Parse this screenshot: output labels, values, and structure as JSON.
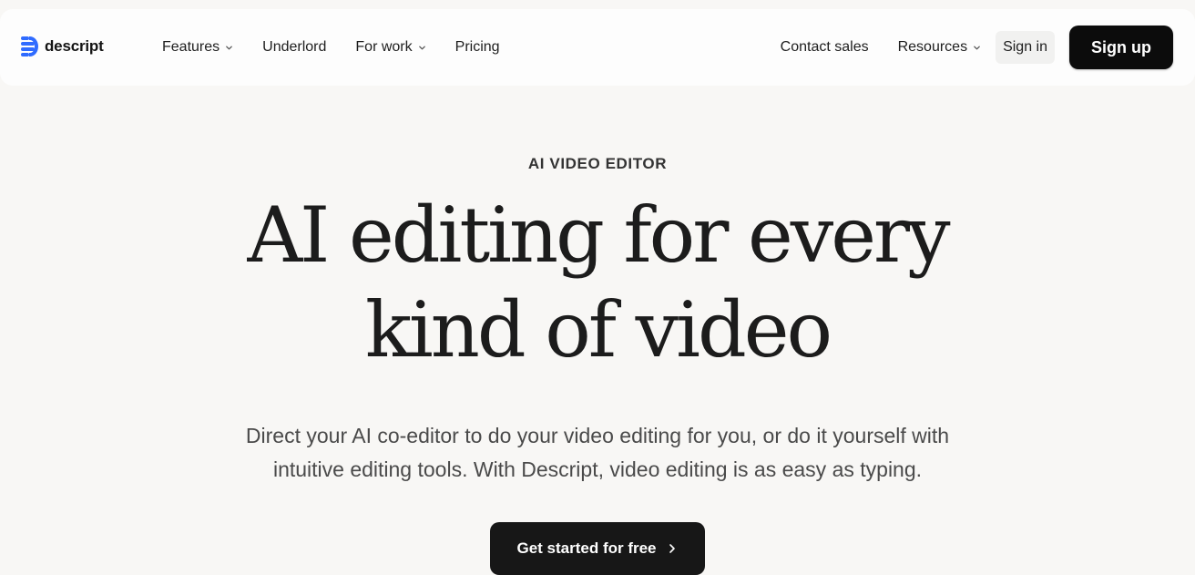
{
  "brand": {
    "name": "descript",
    "logo_icon": "descript-logo-icon",
    "accent_color": "#2f6bff"
  },
  "nav": {
    "left_items": [
      {
        "label": "Features",
        "dropdown": true
      },
      {
        "label": "Underlord",
        "dropdown": false
      },
      {
        "label": "For work",
        "dropdown": true
      },
      {
        "label": "Pricing",
        "dropdown": false
      }
    ],
    "right_items": [
      {
        "label": "Contact sales",
        "dropdown": false
      },
      {
        "label": "Resources",
        "dropdown": true
      }
    ],
    "sign_in_label": "Sign in",
    "sign_up_label": "Sign up",
    "chevron_icon": "chevron-down-icon"
  },
  "hero": {
    "eyebrow": "AI VIDEO EDITOR",
    "headline_line1": "AI editing for every",
    "headline_line2": "kind of video",
    "subcopy_line1": "Direct your AI co-editor to do your video editing for you, or do it yourself with",
    "subcopy_line2": "intuitive editing tools. With Descript, video editing is as easy as typing.",
    "cta_label": "Get started for free",
    "cta_icon": "arrow-right-icon"
  }
}
